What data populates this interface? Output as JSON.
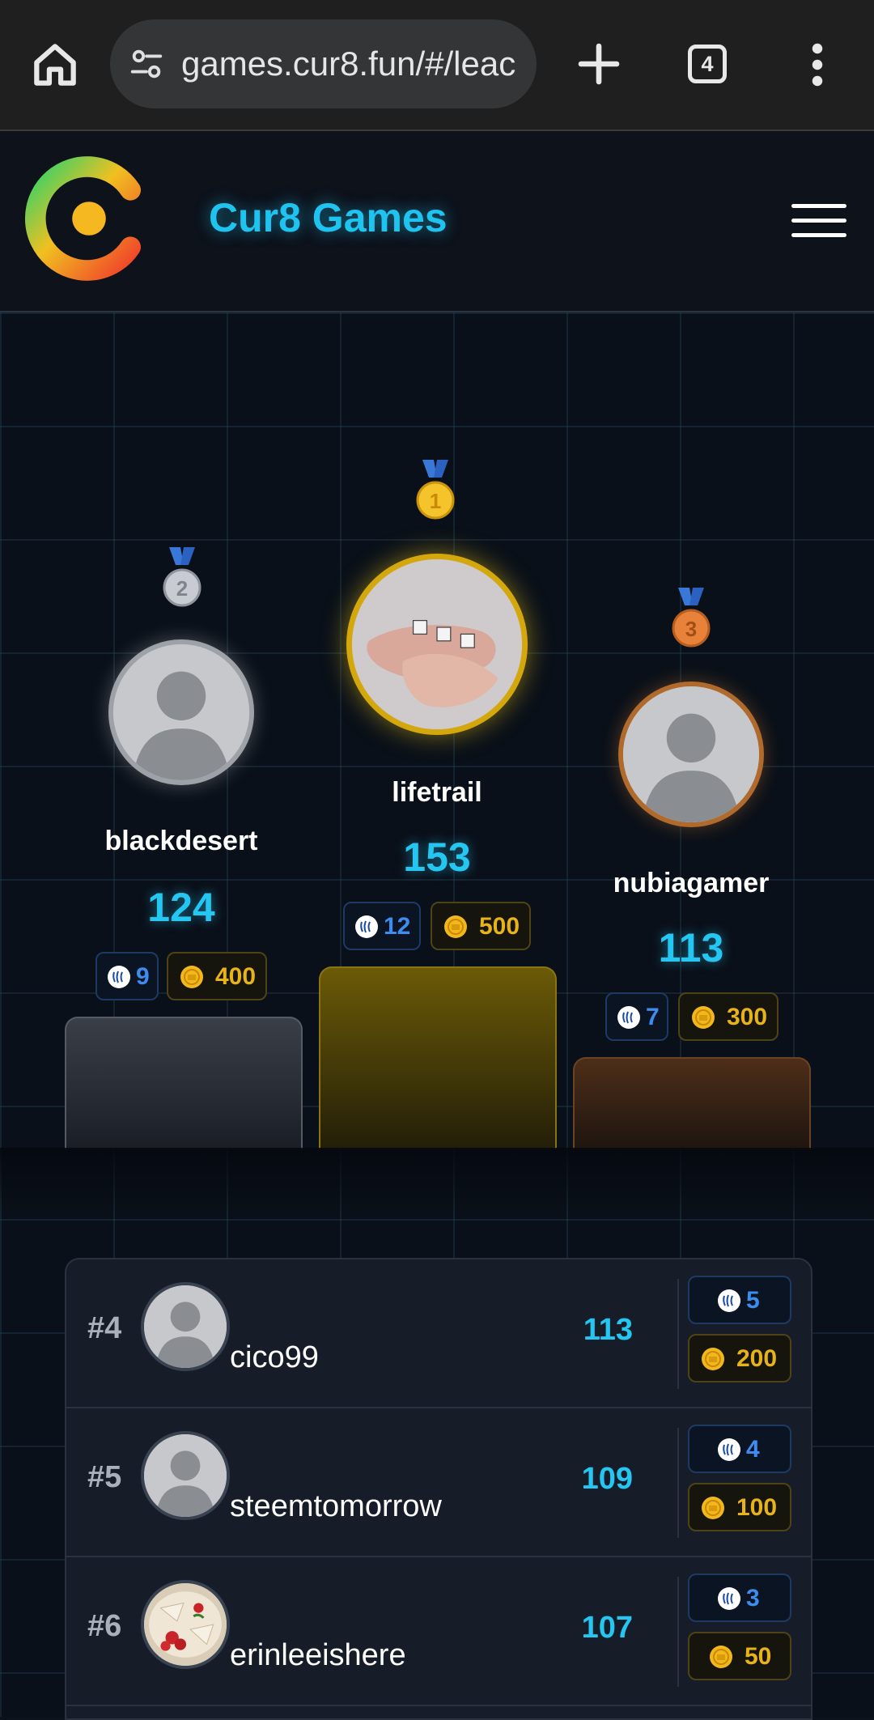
{
  "browser": {
    "url": "games.cur8.fun/#/leac",
    "tab_count": "4"
  },
  "header": {
    "title": "Cur8 Games"
  },
  "podium": {
    "first": {
      "name": "lifetrail",
      "score": "153",
      "steem": "12",
      "coins": "500",
      "medal": "1"
    },
    "second": {
      "name": "blackdesert",
      "score": "124",
      "steem": "9",
      "coins": "400",
      "medal": "2"
    },
    "third": {
      "name": "nubiagamer",
      "score": "113",
      "steem": "7",
      "coins": "300",
      "medal": "3"
    }
  },
  "leaderboard": [
    {
      "rank": "#4",
      "name": "cico99",
      "score": "113",
      "steem": "5",
      "coins": "200"
    },
    {
      "rank": "#5",
      "name": "steemtomorrow",
      "score": "109",
      "steem": "4",
      "coins": "100"
    },
    {
      "rank": "#6",
      "name": "erinleeishere",
      "score": "107",
      "steem": "3",
      "coins": "50"
    }
  ],
  "colors": {
    "accent": "#24c6f2",
    "gold": "#d4a80c",
    "silver": "#9ea2a8",
    "bronze": "#b06a2c",
    "steem": "#3d8df0",
    "coin": "#e8b319"
  }
}
